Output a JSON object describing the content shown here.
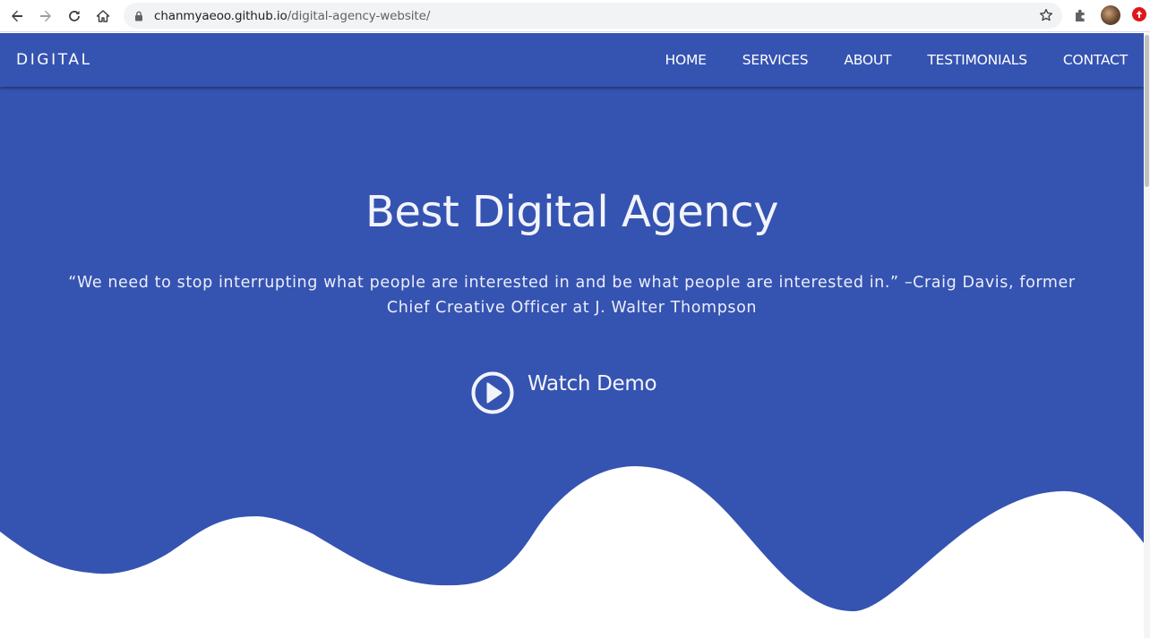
{
  "browser": {
    "url_host": "chanmyaeoo.github.io",
    "url_path": "/digital-agency-website/"
  },
  "site": {
    "brand": "DIGITAL",
    "nav": [
      "HOME",
      "SERVICES",
      "ABOUT",
      "TESTIMONIALS",
      "CONTACT"
    ]
  },
  "hero": {
    "title": "Best Digital Agency",
    "quote_line1": "“We need to stop interrupting what people are interested in and be what people are interested in.” –Craig Davis, former",
    "quote_line2": "Chief Creative Officer at J. Walter Thompson",
    "demo_label": "Watch Demo"
  },
  "colors": {
    "primary": "#3553b1",
    "text": "#ffffff",
    "background": "#ffffff"
  },
  "icons": [
    "back-arrow-icon",
    "forward-arrow-icon",
    "reload-icon",
    "home-icon",
    "lock-icon",
    "star-icon",
    "puzzle-icon",
    "play-circle-icon"
  ]
}
